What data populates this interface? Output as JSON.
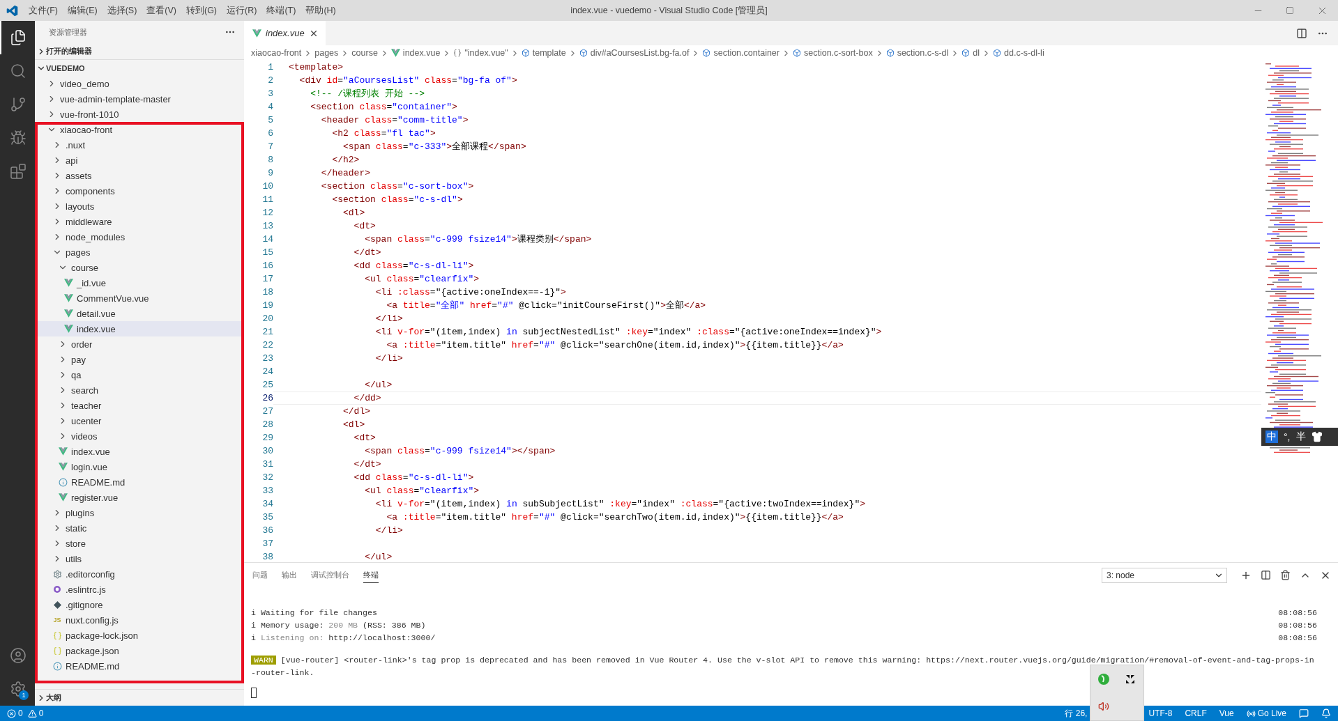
{
  "window": {
    "title": "index.vue - vuedemo - Visual Studio Code [管理员]",
    "menus": [
      "文件(F)",
      "编辑(E)",
      "选择(S)",
      "查看(V)",
      "转到(G)",
      "运行(R)",
      "终端(T)",
      "帮助(H)"
    ]
  },
  "activity_bar": {
    "items": [
      {
        "kind": "files",
        "selected": true
      },
      {
        "kind": "search",
        "selected": false
      },
      {
        "kind": "source-control",
        "selected": false
      },
      {
        "kind": "run",
        "selected": false
      },
      {
        "kind": "extensions",
        "selected": false
      }
    ],
    "settings_badge": "1"
  },
  "sidebar": {
    "title": "资源管理器",
    "open_editors": {
      "label": "打开的编辑器",
      "expanded": false
    },
    "workspace": {
      "label": "VUEDEMO",
      "expanded": true
    },
    "tree": [
      {
        "name": "video_demo",
        "kind": "folder",
        "expanded": false,
        "selected": false,
        "framed": false
      },
      {
        "name": "vue-admin-template-master",
        "kind": "folder",
        "expanded": false,
        "selected": false,
        "framed": false
      },
      {
        "name": "vue-front-1010",
        "kind": "folder",
        "expanded": false,
        "selected": false,
        "framed": false
      },
      {
        "name": "xiaocao-front",
        "kind": "folder",
        "expanded": true,
        "selected": false,
        "framed": true,
        "children": [
          {
            "name": ".nuxt",
            "kind": "folder",
            "expanded": false,
            "selected": false
          },
          {
            "name": "api",
            "kind": "folder",
            "expanded": false,
            "selected": false
          },
          {
            "name": "assets",
            "kind": "folder",
            "expanded": false,
            "selected": false
          },
          {
            "name": "components",
            "kind": "folder",
            "expanded": false,
            "selected": false
          },
          {
            "name": "layouts",
            "kind": "folder",
            "expanded": false,
            "selected": false
          },
          {
            "name": "middleware",
            "kind": "folder",
            "expanded": false,
            "selected": false
          },
          {
            "name": "node_modules",
            "kind": "folder",
            "expanded": false,
            "selected": false
          },
          {
            "name": "pages",
            "kind": "folder",
            "expanded": true,
            "selected": false,
            "children": [
              {
                "name": "course",
                "kind": "folder",
                "expanded": true,
                "selected": false,
                "children": [
                  {
                    "name": "_id.vue",
                    "kind": "vue",
                    "selected": false
                  },
                  {
                    "name": "CommentVue.vue",
                    "kind": "vue",
                    "selected": false
                  },
                  {
                    "name": "detail.vue",
                    "kind": "vue",
                    "selected": false
                  },
                  {
                    "name": "index.vue",
                    "kind": "vue",
                    "selected": true
                  }
                ]
              },
              {
                "name": "order",
                "kind": "folder",
                "expanded": false,
                "selected": false
              },
              {
                "name": "pay",
                "kind": "folder",
                "expanded": false,
                "selected": false
              },
              {
                "name": "qa",
                "kind": "folder",
                "expanded": false,
                "selected": false
              },
              {
                "name": "search",
                "kind": "folder",
                "expanded": false,
                "selected": false
              },
              {
                "name": "teacher",
                "kind": "folder",
                "expanded": false,
                "selected": false
              },
              {
                "name": "ucenter",
                "kind": "folder",
                "expanded": false,
                "selected": false
              },
              {
                "name": "videos",
                "kind": "folder",
                "expanded": false,
                "selected": false
              },
              {
                "name": "index.vue",
                "kind": "vue",
                "selected": false
              },
              {
                "name": "login.vue",
                "kind": "vue",
                "selected": false
              },
              {
                "name": "README.md",
                "kind": "info",
                "selected": false
              },
              {
                "name": "register.vue",
                "kind": "vue",
                "selected": false
              }
            ]
          },
          {
            "name": "plugins",
            "kind": "folder",
            "expanded": false,
            "selected": false
          },
          {
            "name": "static",
            "kind": "folder",
            "expanded": false,
            "selected": false
          },
          {
            "name": "store",
            "kind": "folder",
            "expanded": false,
            "selected": false
          },
          {
            "name": "utils",
            "kind": "folder",
            "expanded": false,
            "selected": false
          },
          {
            "name": ".editorconfig",
            "kind": "gear",
            "selected": false
          },
          {
            "name": ".eslintrc.js",
            "kind": "eslint",
            "selected": false
          },
          {
            "name": ".gitignore",
            "kind": "git",
            "selected": false
          },
          {
            "name": "nuxt.config.js",
            "kind": "js",
            "badge": "JS",
            "selected": false
          },
          {
            "name": "package-lock.json",
            "kind": "json",
            "selected": false
          },
          {
            "name": "package.json",
            "kind": "json",
            "selected": false
          },
          {
            "name": "README.md",
            "kind": "info",
            "selected": false
          }
        ]
      }
    ],
    "outline": {
      "label": "大纲",
      "expanded": false
    }
  },
  "editor": {
    "tabs": [
      {
        "label": "index.vue",
        "selected": true,
        "preview": true
      }
    ],
    "breadcrumbs": [
      {
        "kind": "folder",
        "label": "xiaocao-front"
      },
      {
        "kind": "folder",
        "label": "pages"
      },
      {
        "kind": "folder",
        "label": "course"
      },
      {
        "kind": "vue",
        "label": "index.vue"
      },
      {
        "kind": "braces",
        "label": "\"index.vue\""
      },
      {
        "kind": "symbol",
        "label": "template"
      },
      {
        "kind": "symbol",
        "label": "div#aCoursesList.bg-fa.of"
      },
      {
        "kind": "symbol",
        "label": "section.container"
      },
      {
        "kind": "symbol",
        "label": "section.c-sort-box"
      },
      {
        "kind": "symbol",
        "label": "section.c-s-dl"
      },
      {
        "kind": "symbol",
        "label": "dl"
      },
      {
        "kind": "symbol",
        "label": "dd.c-s-dl-li"
      }
    ],
    "lines": [
      {
        "number": "1",
        "current": false,
        "tokens": [
          {
            "kind": "tag",
            "text": "<template>"
          }
        ]
      },
      {
        "number": "2",
        "current": false,
        "tokens": [
          {
            "kind": "tag",
            "text": "  <div"
          },
          {
            "kind": "attr",
            "text": " id"
          },
          {
            "kind": "plain",
            "text": "="
          },
          {
            "kind": "string",
            "text": "\"aCoursesList\""
          },
          {
            "kind": "attr",
            "text": " class"
          },
          {
            "kind": "plain",
            "text": "="
          },
          {
            "kind": "string",
            "text": "\"bg-fa of\""
          },
          {
            "kind": "tag",
            "text": ">"
          }
        ]
      },
      {
        "number": "3",
        "current": false,
        "tokens": [
          {
            "kind": "comment",
            "text": "    <!-- /课程列表 开始 -->"
          }
        ]
      },
      {
        "number": "4",
        "current": false,
        "tokens": [
          {
            "kind": "tag",
            "text": "    <section"
          },
          {
            "kind": "attr",
            "text": " class"
          },
          {
            "kind": "plain",
            "text": "="
          },
          {
            "kind": "string",
            "text": "\"container\""
          },
          {
            "kind": "tag",
            "text": ">"
          }
        ]
      },
      {
        "number": "5",
        "current": false,
        "tokens": [
          {
            "kind": "tag",
            "text": "      <header"
          },
          {
            "kind": "attr",
            "text": " class"
          },
          {
            "kind": "plain",
            "text": "="
          },
          {
            "kind": "string",
            "text": "\"comm-title\""
          },
          {
            "kind": "tag",
            "text": ">"
          }
        ]
      },
      {
        "number": "6",
        "current": false,
        "tokens": [
          {
            "kind": "tag",
            "text": "        <h2"
          },
          {
            "kind": "attr",
            "text": " class"
          },
          {
            "kind": "plain",
            "text": "="
          },
          {
            "kind": "string",
            "text": "\"fl tac\""
          },
          {
            "kind": "tag",
            "text": ">"
          }
        ]
      },
      {
        "number": "7",
        "current": false,
        "tokens": [
          {
            "kind": "tag",
            "text": "          <span"
          },
          {
            "kind": "attr",
            "text": " class"
          },
          {
            "kind": "plain",
            "text": "="
          },
          {
            "kind": "string",
            "text": "\"c-333\""
          },
          {
            "kind": "tag",
            "text": ">"
          },
          {
            "kind": "plain",
            "text": "全部课程"
          },
          {
            "kind": "tag",
            "text": "</span>"
          }
        ]
      },
      {
        "number": "8",
        "current": false,
        "tokens": [
          {
            "kind": "tag",
            "text": "        </h2>"
          }
        ]
      },
      {
        "number": "9",
        "current": false,
        "tokens": [
          {
            "kind": "tag",
            "text": "      </header>"
          }
        ]
      },
      {
        "number": "10",
        "current": false,
        "tokens": [
          {
            "kind": "tag",
            "text": "      <section"
          },
          {
            "kind": "attr",
            "text": " class"
          },
          {
            "kind": "plain",
            "text": "="
          },
          {
            "kind": "string",
            "text": "\"c-sort-box\""
          },
          {
            "kind": "tag",
            "text": ">"
          }
        ]
      },
      {
        "number": "11",
        "current": false,
        "tokens": [
          {
            "kind": "tag",
            "text": "        <section"
          },
          {
            "kind": "attr",
            "text": " class"
          },
          {
            "kind": "plain",
            "text": "="
          },
          {
            "kind": "string",
            "text": "\"c-s-dl\""
          },
          {
            "kind": "tag",
            "text": ">"
          }
        ]
      },
      {
        "number": "12",
        "current": false,
        "tokens": [
          {
            "kind": "tag",
            "text": "          <dl>"
          }
        ]
      },
      {
        "number": "13",
        "current": false,
        "tokens": [
          {
            "kind": "tag",
            "text": "            <dt>"
          }
        ]
      },
      {
        "number": "14",
        "current": false,
        "tokens": [
          {
            "kind": "tag",
            "text": "              <span"
          },
          {
            "kind": "attr",
            "text": " class"
          },
          {
            "kind": "plain",
            "text": "="
          },
          {
            "kind": "string",
            "text": "\"c-999 fsize14\""
          },
          {
            "kind": "tag",
            "text": ">"
          },
          {
            "kind": "plain",
            "text": "课程类别"
          },
          {
            "kind": "tag",
            "text": "</span>"
          }
        ]
      },
      {
        "number": "15",
        "current": false,
        "tokens": [
          {
            "kind": "tag",
            "text": "            </dt>"
          }
        ]
      },
      {
        "number": "16",
        "current": false,
        "tokens": [
          {
            "kind": "tag",
            "text": "            <dd"
          },
          {
            "kind": "attr",
            "text": " class"
          },
          {
            "kind": "plain",
            "text": "="
          },
          {
            "kind": "string",
            "text": "\"c-s-dl-li\""
          },
          {
            "kind": "tag",
            "text": ">"
          }
        ]
      },
      {
        "number": "17",
        "current": false,
        "tokens": [
          {
            "kind": "tag",
            "text": "              <ul"
          },
          {
            "kind": "attr",
            "text": " class"
          },
          {
            "kind": "plain",
            "text": "="
          },
          {
            "kind": "string",
            "text": "\"clearfix\""
          },
          {
            "kind": "tag",
            "text": ">"
          }
        ]
      },
      {
        "number": "18",
        "current": false,
        "tokens": [
          {
            "kind": "tag",
            "text": "                <li"
          },
          {
            "kind": "attr",
            "text": " :class"
          },
          {
            "kind": "plain",
            "text": "=\"{active:oneIndex==-1}\""
          },
          {
            "kind": "tag",
            "text": ">"
          }
        ]
      },
      {
        "number": "19",
        "current": false,
        "tokens": [
          {
            "kind": "tag",
            "text": "                  <a"
          },
          {
            "kind": "attr",
            "text": " title"
          },
          {
            "kind": "plain",
            "text": "="
          },
          {
            "kind": "string",
            "text": "\"全部\""
          },
          {
            "kind": "attr",
            "text": " href"
          },
          {
            "kind": "plain",
            "text": "="
          },
          {
            "kind": "string",
            "text": "\"#\""
          },
          {
            "kind": "plain",
            "text": " @click=\"initCourseFirst()\""
          },
          {
            "kind": "tag",
            "text": ">"
          },
          {
            "kind": "plain",
            "text": "全部"
          },
          {
            "kind": "tag",
            "text": "</a>"
          }
        ]
      },
      {
        "number": "20",
        "current": false,
        "tokens": [
          {
            "kind": "tag",
            "text": "                </li>"
          }
        ]
      },
      {
        "number": "21",
        "current": false,
        "tokens": [
          {
            "kind": "tag",
            "text": "                <li"
          },
          {
            "kind": "attr",
            "text": " v-for"
          },
          {
            "kind": "plain",
            "text": "=\"(item,index) "
          },
          {
            "kind": "keyword",
            "text": "in"
          },
          {
            "kind": "plain",
            "text": " subjectNestedList\""
          },
          {
            "kind": "attr",
            "text": " :key"
          },
          {
            "kind": "plain",
            "text": "=\"index\""
          },
          {
            "kind": "attr",
            "text": " :class"
          },
          {
            "kind": "plain",
            "text": "=\"{active:oneIndex==index}\""
          },
          {
            "kind": "tag",
            "text": ">"
          }
        ]
      },
      {
        "number": "22",
        "current": false,
        "tokens": [
          {
            "kind": "tag",
            "text": "                  <a"
          },
          {
            "kind": "attr",
            "text": " :title"
          },
          {
            "kind": "plain",
            "text": "=\"item.title\""
          },
          {
            "kind": "attr",
            "text": " href"
          },
          {
            "kind": "plain",
            "text": "="
          },
          {
            "kind": "string",
            "text": "\"#\""
          },
          {
            "kind": "plain",
            "text": " @click=\"searchOne(item.id,index)\""
          },
          {
            "kind": "tag",
            "text": ">"
          },
          {
            "kind": "plain",
            "text": "{{item.title}}"
          },
          {
            "kind": "tag",
            "text": "</a>"
          }
        ]
      },
      {
        "number": "23",
        "current": false,
        "tokens": [
          {
            "kind": "tag",
            "text": "                </li>"
          }
        ]
      },
      {
        "number": "24",
        "current": false
      },
      {
        "number": "25",
        "current": false,
        "tokens": [
          {
            "kind": "tag",
            "text": "              </ul>"
          }
        ]
      },
      {
        "number": "26",
        "current": true,
        "tokens": [
          {
            "kind": "tag",
            "text": "            </dd>"
          }
        ]
      },
      {
        "number": "27",
        "current": false,
        "tokens": [
          {
            "kind": "tag",
            "text": "          </dl>"
          }
        ]
      },
      {
        "number": "28",
        "current": false,
        "tokens": [
          {
            "kind": "tag",
            "text": "          <dl>"
          }
        ]
      },
      {
        "number": "29",
        "current": false,
        "tokens": [
          {
            "kind": "tag",
            "text": "            <dt>"
          }
        ]
      },
      {
        "number": "30",
        "current": false,
        "tokens": [
          {
            "kind": "tag",
            "text": "              <span"
          },
          {
            "kind": "attr",
            "text": " class"
          },
          {
            "kind": "plain",
            "text": "="
          },
          {
            "kind": "string",
            "text": "\"c-999 fsize14\""
          },
          {
            "kind": "tag",
            "text": "></span>"
          }
        ]
      },
      {
        "number": "31",
        "current": false,
        "tokens": [
          {
            "kind": "tag",
            "text": "            </dt>"
          }
        ]
      },
      {
        "number": "32",
        "current": false,
        "tokens": [
          {
            "kind": "tag",
            "text": "            <dd"
          },
          {
            "kind": "attr",
            "text": " class"
          },
          {
            "kind": "plain",
            "text": "="
          },
          {
            "kind": "string",
            "text": "\"c-s-dl-li\""
          },
          {
            "kind": "tag",
            "text": ">"
          }
        ]
      },
      {
        "number": "33",
        "current": false,
        "tokens": [
          {
            "kind": "tag",
            "text": "              <ul"
          },
          {
            "kind": "attr",
            "text": " class"
          },
          {
            "kind": "plain",
            "text": "="
          },
          {
            "kind": "string",
            "text": "\"clearfix\""
          },
          {
            "kind": "tag",
            "text": ">"
          }
        ]
      },
      {
        "number": "34",
        "current": false,
        "tokens": [
          {
            "kind": "tag",
            "text": "                <li"
          },
          {
            "kind": "attr",
            "text": " v-for"
          },
          {
            "kind": "plain",
            "text": "=\"(item,index) "
          },
          {
            "kind": "keyword",
            "text": "in"
          },
          {
            "kind": "plain",
            "text": " subSubjectList\""
          },
          {
            "kind": "attr",
            "text": " :key"
          },
          {
            "kind": "plain",
            "text": "=\"index\""
          },
          {
            "kind": "attr",
            "text": " :class"
          },
          {
            "kind": "plain",
            "text": "=\"{active:twoIndex==index}\""
          },
          {
            "kind": "tag",
            "text": ">"
          }
        ]
      },
      {
        "number": "35",
        "current": false,
        "tokens": [
          {
            "kind": "tag",
            "text": "                  <a"
          },
          {
            "kind": "attr",
            "text": " :title"
          },
          {
            "kind": "plain",
            "text": "=\"item.title\""
          },
          {
            "kind": "attr",
            "text": " href"
          },
          {
            "kind": "plain",
            "text": "="
          },
          {
            "kind": "string",
            "text": "\"#\""
          },
          {
            "kind": "plain",
            "text": " @click=\"searchTwo(item.id,index)\""
          },
          {
            "kind": "tag",
            "text": ">"
          },
          {
            "kind": "plain",
            "text": "{{item.title}}"
          },
          {
            "kind": "tag",
            "text": "</a>"
          }
        ]
      },
      {
        "number": "36",
        "current": false,
        "tokens": [
          {
            "kind": "tag",
            "text": "                </li>"
          }
        ]
      },
      {
        "number": "37",
        "current": false
      },
      {
        "number": "38",
        "current": false,
        "tokens": [
          {
            "kind": "tag",
            "text": "              </ul>"
          }
        ]
      }
    ]
  },
  "panel": {
    "tabs": [
      {
        "label": "问题",
        "selected": false
      },
      {
        "label": "输出",
        "selected": false
      },
      {
        "label": "调试控制台",
        "selected": false
      },
      {
        "label": "终端",
        "selected": true
      }
    ],
    "terminal_select": "3: node",
    "lines": [
      {
        "segments": [
          {
            "kind": "plain",
            "text": "i Waiting for file changes"
          }
        ],
        "time": "08:08:56"
      },
      {
        "segments": [
          {
            "kind": "plain",
            "text": "i Memory usage: "
          },
          {
            "kind": "dim",
            "text": "200 MB"
          },
          {
            "kind": "plain",
            "text": " (RSS: 386 MB)"
          }
        ],
        "time": "08:08:56"
      },
      {
        "segments": [
          {
            "kind": "plain",
            "text": "i "
          },
          {
            "kind": "dim",
            "text": "Listening on:"
          },
          {
            "kind": "plain",
            "text": " http://localhost:3000/"
          }
        ],
        "time": "08:08:56"
      }
    ],
    "warning": {
      "badge": "WARN",
      "text": " [vue-router] <router-link>'s tag prop is deprecated and has been removed in Vue Router 4. Use the v-slot API to remove this warning: https://next.router.vuejs.org/guide/migration/#removal-of-event-and-tag-props-in-router-link."
    }
  },
  "status_bar": {
    "errors": "0",
    "warnings": "0",
    "position": "行 26,",
    "encoding": "UTF-8",
    "eol": "CRLF",
    "language": "Vue",
    "go_live": "Go Live"
  },
  "ime_bar": {
    "mode": "中",
    "punct": "°,",
    "width": "半"
  }
}
